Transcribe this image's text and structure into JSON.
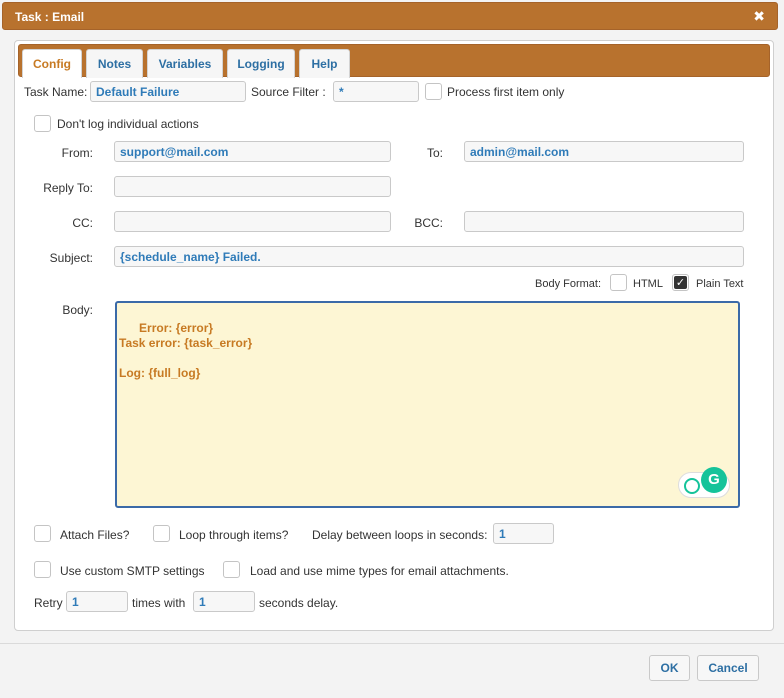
{
  "window": {
    "title": "Task : Email",
    "close_glyph": "✖"
  },
  "tabs": [
    {
      "label": "Config",
      "active": true
    },
    {
      "label": "Notes",
      "active": false
    },
    {
      "label": "Variables",
      "active": false
    },
    {
      "label": "Logging",
      "active": false
    },
    {
      "label": "Help",
      "active": false
    }
  ],
  "config": {
    "task_name_label": "Task Name:",
    "task_name_value": "Default Failure",
    "source_filter_label": "Source Filter :",
    "source_filter_value": "*",
    "process_first_label": "Process first item only",
    "process_first_checked": false,
    "dont_log_label": "Don't log individual actions",
    "dont_log_checked": false,
    "from_label": "From:",
    "from_value": "support@mail.com",
    "to_label": "To:",
    "to_value": "admin@mail.com",
    "reply_to_label": "Reply To:",
    "reply_to_value": "",
    "cc_label": "CC:",
    "cc_value": "",
    "bcc_label": "BCC:",
    "bcc_value": "",
    "subject_label": "Subject:",
    "subject_value": "{schedule_name} Failed.",
    "body_format_label": "Body Format:",
    "html_label": "HTML",
    "html_checked": false,
    "plain_text_label": "Plain Text",
    "plain_text_checked": true,
    "body_label": "Body:",
    "body_value": "Error: {error}\nTask error: {task_error}\n\nLog: {full_log}",
    "attach_files_label": "Attach Files?",
    "attach_files_checked": false,
    "loop_items_label": "Loop through items?",
    "loop_items_checked": false,
    "delay_label": "Delay between loops in seconds:",
    "delay_value": "1",
    "custom_smtp_label": "Use custom SMTP settings",
    "custom_smtp_checked": false,
    "mime_types_label": "Load and use mime types for email attachments.",
    "mime_types_checked": false,
    "retry_label": "Retry",
    "retry_value": "1",
    "times_with_label": "times with",
    "seconds_value": "1",
    "seconds_delay_label": "seconds delay."
  },
  "footer": {
    "ok_label": "OK",
    "cancel_label": "Cancel"
  },
  "colors": {
    "accent": "#b8722e",
    "link": "#2d6fa3",
    "body_bg": "#fdf6d4",
    "body_text": "#c77a23"
  }
}
